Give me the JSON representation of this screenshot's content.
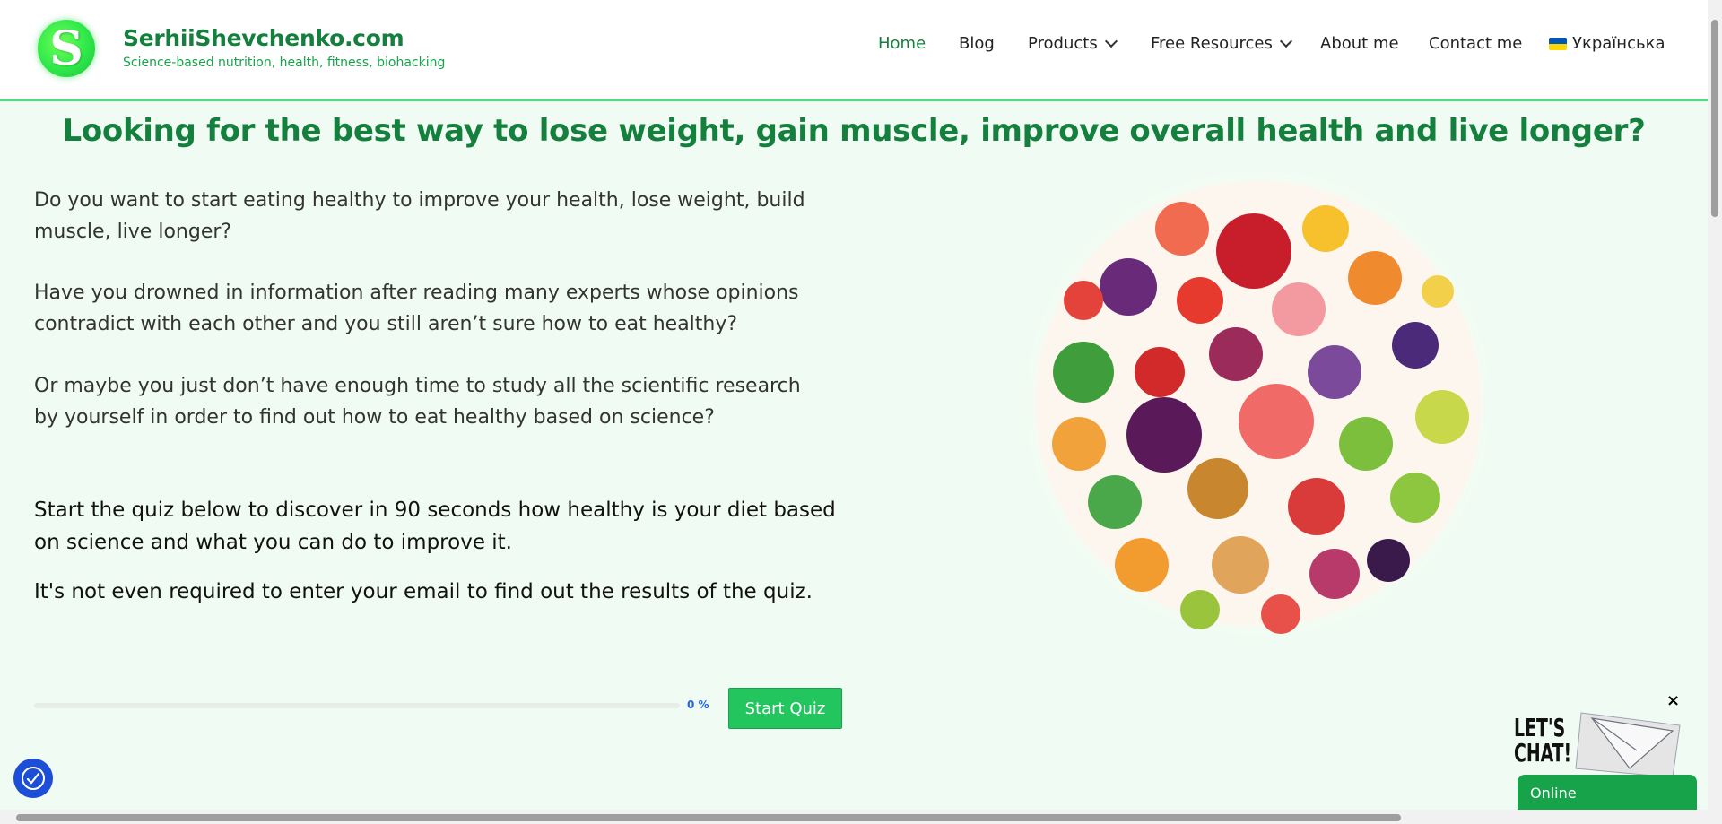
{
  "header": {
    "logo_letter": "S",
    "site_title": "SerhiiShevchenko.com",
    "tagline": "Science-based nutrition, health, fitness, biohacking"
  },
  "nav": {
    "items": [
      {
        "label": "Home",
        "active": true
      },
      {
        "label": "Blog"
      },
      {
        "label": "Products",
        "dropdown": true
      },
      {
        "label": "Free Resources",
        "dropdown": true
      },
      {
        "label": "About me"
      },
      {
        "label": "Contact me"
      },
      {
        "label": "Українська",
        "icon": "ukraine-flag-icon"
      }
    ]
  },
  "main": {
    "headline": "Looking for the best way to lose weight, gain muscle, improve overall health and live longer?",
    "paragraphs": [
      "Do you want to start eating healthy to improve your health, lose weight, build muscle, live longer?",
      "Have you drowned in information after reading many experts whose opinions contradict with each other and you still aren’t sure how to eat healthy?",
      "Or maybe you just don’t have enough time to study all the scientific research by yourself in order to find out how to eat healthy based on science?"
    ],
    "quiz_intro": "Start the quiz below to discover in 90 seconds how healthy is your diet based on science and what you can do to improve it.",
    "quiz_note": "It's not even required to enter your email to find out the results of the quiz."
  },
  "quiz": {
    "progress_text": "0 %",
    "progress_fraction": 0,
    "start_label": "Start Quiz"
  },
  "chat": {
    "headline": "LET'S CHAT!",
    "status": "Online",
    "close": "×"
  },
  "colors": {
    "brand_green": "#15803d",
    "accent_green": "#22c55e",
    "page_bg": "#f0fcf3"
  }
}
